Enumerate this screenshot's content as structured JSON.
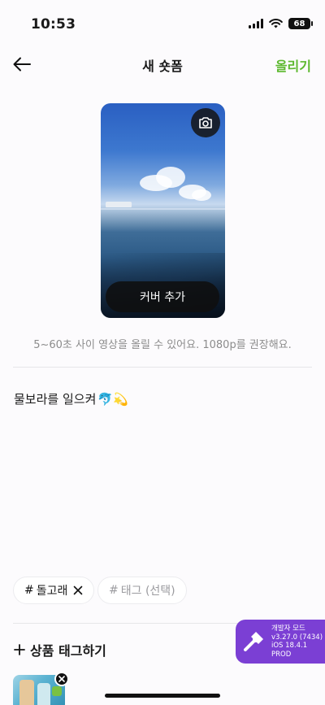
{
  "status_bar": {
    "time": "10:53",
    "battery": "68"
  },
  "nav": {
    "title": "새 숏폼",
    "upload_label": "올리기"
  },
  "video": {
    "cover_button": "커버 추가"
  },
  "hint": "5~60초 사이 영상을 올릴 수 있어요. 1080p를 권장해요.",
  "caption": {
    "text": "물보라를 일으켜",
    "emoji": "🐬💫"
  },
  "tags": {
    "items": [
      {
        "hash": "#",
        "label": "돌고래"
      }
    ],
    "placeholder": "태그 (선택)"
  },
  "product_tag": {
    "label": "상품 태그하기"
  },
  "dev_badge": {
    "line1": "개발자 모드",
    "line2": "v3.27.0 (7434)",
    "line3": "iOS 18.4.1",
    "line4": "PROD"
  },
  "colors": {
    "accent": "#5cb82e",
    "dev_purple": "#7b3fd4"
  }
}
